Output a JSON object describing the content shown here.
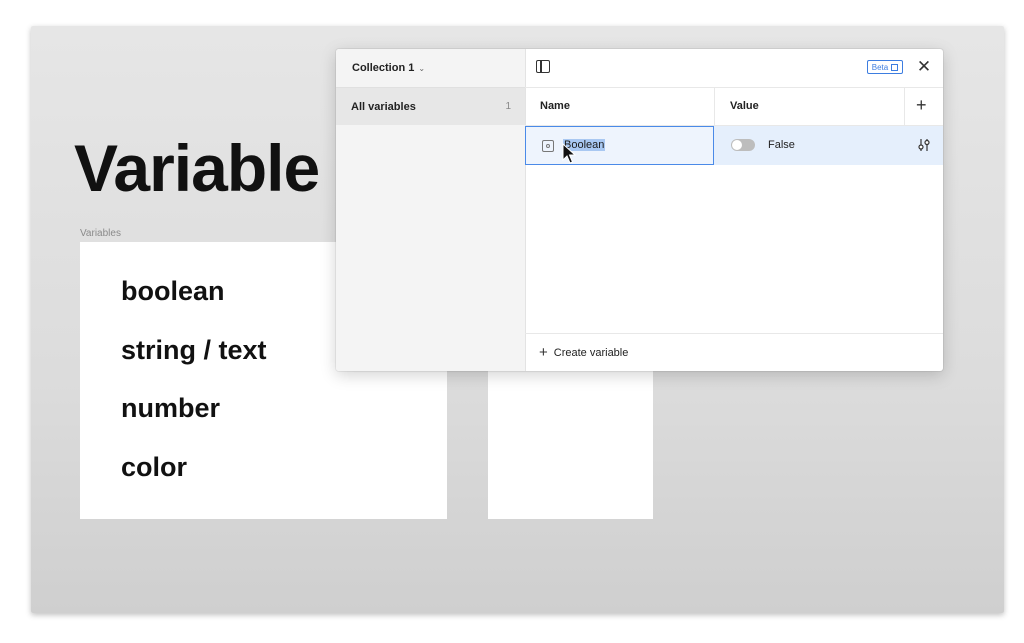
{
  "background": {
    "heading": "Variable",
    "frame_label": "Variables",
    "frame_items": [
      "boolean",
      "string / text",
      "number",
      "color"
    ]
  },
  "modal": {
    "collection": "Collection 1",
    "sidebar": {
      "item_label": "All variables",
      "item_count": "1"
    },
    "toolbar": {
      "beta_label": "Beta",
      "close_icon": "close-icon"
    },
    "table": {
      "headers": {
        "name": "Name",
        "value": "Value"
      },
      "rows": [
        {
          "name": "Boolean",
          "value": "False",
          "type": "boolean",
          "toggle_on": false
        }
      ]
    },
    "footer": {
      "create_label": "Create variable"
    }
  },
  "colors": {
    "accent": "#3d7de0",
    "selection": "#a9c8f2",
    "row_highlight": "#e5effc"
  }
}
